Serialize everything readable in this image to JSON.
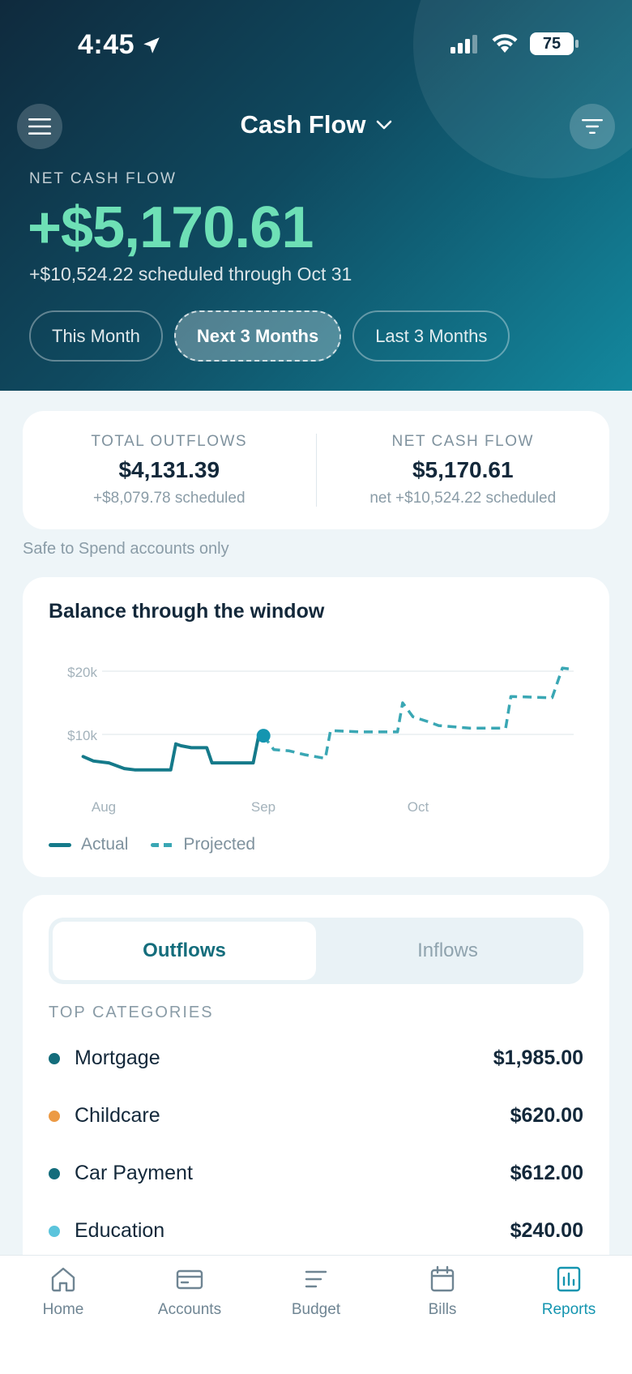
{
  "status": {
    "time": "4:45",
    "battery": "75"
  },
  "header": {
    "title": "Cash Flow"
  },
  "hero": {
    "label": "NET CASH FLOW",
    "amount": "+$5,170.61",
    "subtitle": "+$10,524.22 scheduled through Oct 31",
    "periods": [
      {
        "label": "This Month",
        "active": false
      },
      {
        "label": "Next 3 Months",
        "active": true
      },
      {
        "label": "Last 3 Months",
        "active": false
      }
    ]
  },
  "summary": {
    "outflows": {
      "label": "TOTAL OUTFLOWS",
      "value": "$4,131.39",
      "sub": "+$8,079.78 scheduled"
    },
    "net": {
      "label": "NET CASH FLOW",
      "value": "$5,170.61",
      "sub": "net +$10,524.22 scheduled"
    }
  },
  "safe_note": "Safe to Spend accounts only",
  "chart_data": {
    "type": "line",
    "title": "Balance through the window",
    "y_ticks": [
      "$20k",
      "$10k"
    ],
    "x_ticks": [
      "Aug",
      "Sep",
      "Oct"
    ],
    "ylim": [
      0,
      22000
    ],
    "series": [
      {
        "name": "Actual",
        "style": "solid",
        "color": "#157a8a",
        "x": [
          "2024-07-28",
          "2024-07-30",
          "2024-08-02",
          "2024-08-05",
          "2024-08-07",
          "2024-08-10",
          "2024-08-14",
          "2024-08-15",
          "2024-08-16",
          "2024-08-18",
          "2024-08-21",
          "2024-08-22",
          "2024-08-25",
          "2024-08-30",
          "2024-08-31",
          "2024-09-01"
        ],
        "y": [
          6500,
          5800,
          5500,
          4600,
          4400,
          4400,
          4400,
          8500,
          8200,
          7900,
          7900,
          5500,
          5500,
          5500,
          9500,
          9800
        ]
      },
      {
        "name": "Projected",
        "style": "dashed",
        "color": "#3aa7b4",
        "x": [
          "2024-09-01",
          "2024-09-03",
          "2024-09-06",
          "2024-09-09",
          "2024-09-13",
          "2024-09-14",
          "2024-09-20",
          "2024-09-27",
          "2024-09-28",
          "2024-09-30",
          "2024-10-03",
          "2024-10-05",
          "2024-10-11",
          "2024-10-18",
          "2024-10-19",
          "2024-10-27",
          "2024-10-29",
          "2024-10-31"
        ],
        "y": [
          9800,
          7600,
          7400,
          6800,
          6200,
          10600,
          10400,
          10400,
          15000,
          12800,
          12000,
          11400,
          11000,
          11000,
          16000,
          15800,
          20500,
          20300
        ]
      }
    ]
  },
  "legend": {
    "actual": "Actual",
    "projected": "Projected"
  },
  "tabs": {
    "outflows": "Outflows",
    "inflows": "Inflows"
  },
  "top_categories_label": "TOP CATEGORIES",
  "categories": [
    {
      "name": "Mortgage",
      "amount": "$1,985.00",
      "color": "#146d7c"
    },
    {
      "name": "Childcare",
      "amount": "$620.00",
      "color": "#ec9a45"
    },
    {
      "name": "Car Payment",
      "amount": "$612.00",
      "color": "#146d7c"
    },
    {
      "name": "Education",
      "amount": "$240.00",
      "color": "#5bc4dc"
    }
  ],
  "nav": [
    {
      "label": "Home",
      "icon": "home-icon",
      "active": false
    },
    {
      "label": "Accounts",
      "icon": "card-icon",
      "active": false
    },
    {
      "label": "Budget",
      "icon": "budget-lines-icon",
      "active": false
    },
    {
      "label": "Bills",
      "icon": "calendar-icon",
      "active": false
    },
    {
      "label": "Reports",
      "icon": "bar-chart-icon",
      "active": true
    }
  ]
}
